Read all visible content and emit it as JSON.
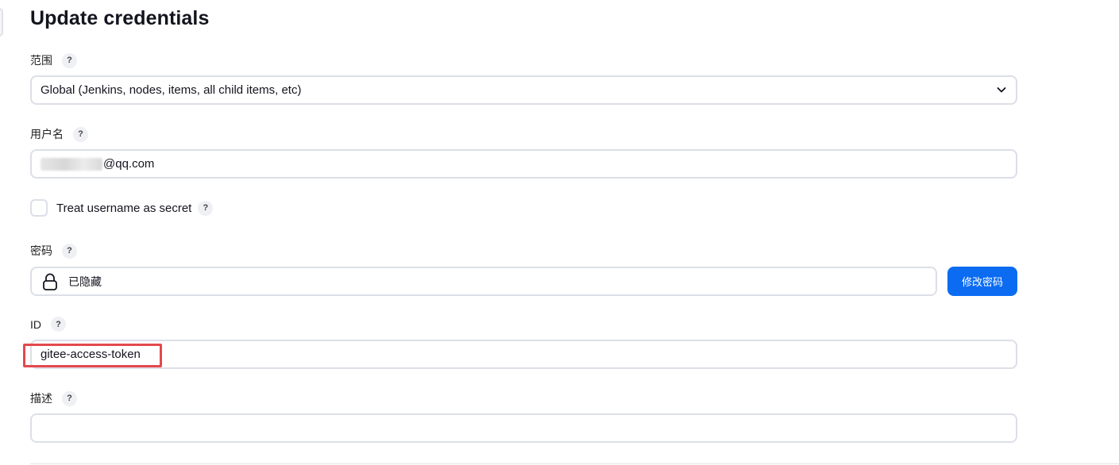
{
  "page": {
    "title": "Update credentials"
  },
  "form": {
    "scope": {
      "label": "范围",
      "help": "?",
      "value": "Global (Jenkins, nodes, items, all child items, etc)"
    },
    "username": {
      "label": "用户名",
      "help": "?",
      "value_visible": "@qq.com"
    },
    "treat_username_secret": {
      "label": "Treat username as secret",
      "help": "?",
      "checked": false
    },
    "password": {
      "label": "密码",
      "help": "?",
      "value": "已隐藏",
      "change_button": "修改密码"
    },
    "id": {
      "label": "ID",
      "help": "?",
      "value": "gitee-access-token"
    },
    "description": {
      "label": "描述",
      "help": "?",
      "value": ""
    }
  },
  "colors": {
    "accent": "#0b6cf2",
    "highlight": "#e5484d",
    "border": "#dcdfe7"
  },
  "icons": [
    "chevron-down-icon",
    "lock-icon",
    "help-icon"
  ]
}
